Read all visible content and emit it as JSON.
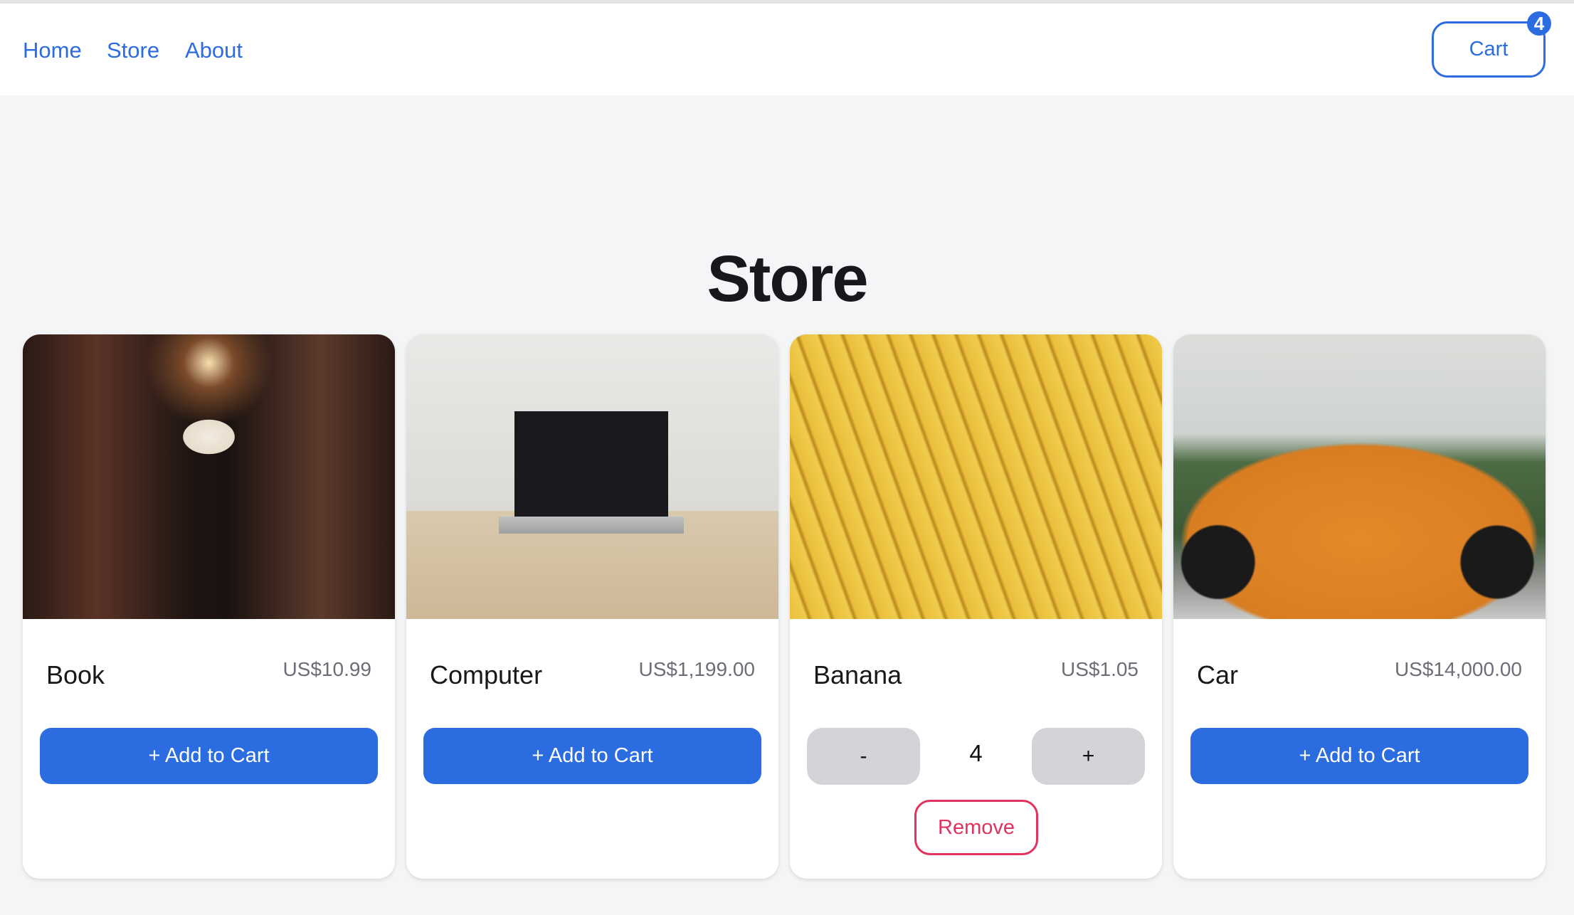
{
  "nav": {
    "links": [
      "Home",
      "Store",
      "About"
    ],
    "cart_label": "Cart",
    "cart_count": "4"
  },
  "page": {
    "title": "Store"
  },
  "products": [
    {
      "name": "Book",
      "price": "US$10.99",
      "action": "+ Add to Cart"
    },
    {
      "name": "Computer",
      "price": "US$1,199.00",
      "action": "+ Add to Cart"
    },
    {
      "name": "Banana",
      "price": "US$1.05",
      "quantity": "4",
      "decrement": "-",
      "increment": "+",
      "remove": "Remove"
    },
    {
      "name": "Car",
      "price": "US$14,000.00",
      "action": "+ Add to Cart"
    }
  ],
  "colors": {
    "accent": "#2b6ce0",
    "danger": "#e0335f"
  }
}
